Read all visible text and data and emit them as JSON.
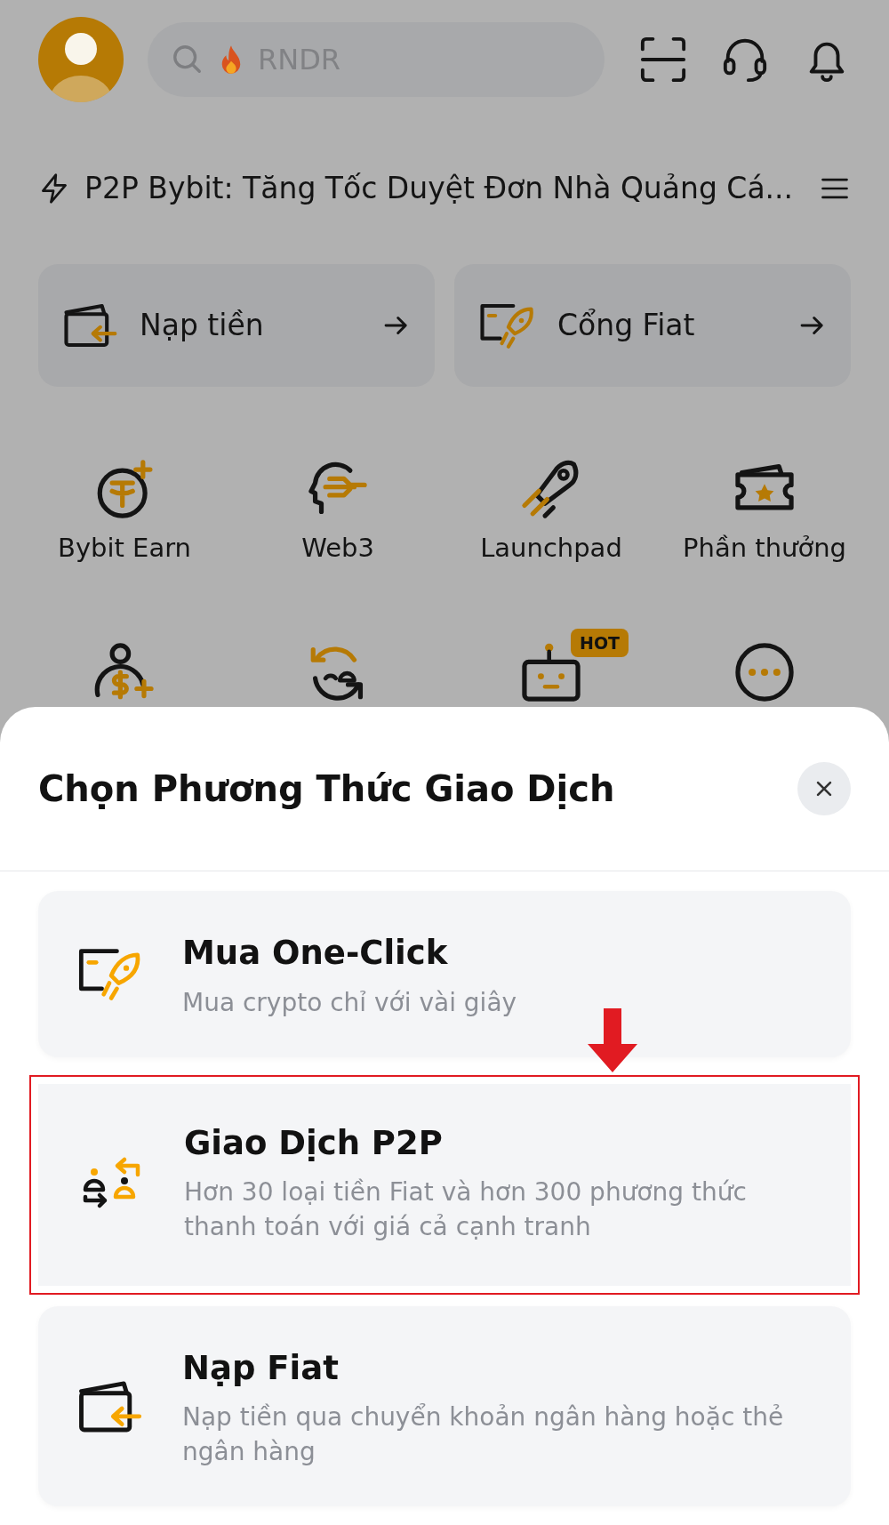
{
  "header": {
    "search": {
      "placeholder": "RNDR"
    }
  },
  "announcement": {
    "text": "P2P Bybit: Tăng Tốc Duyệt Đơn Nhà Quảng Cá..."
  },
  "quick_actions": [
    {
      "kind": "deposit",
      "label": "Nạp tiền"
    },
    {
      "kind": "fiat",
      "label": "Cổng Fiat"
    }
  ],
  "shortcuts": [
    {
      "kind": "earn",
      "label": "Bybit Earn"
    },
    {
      "kind": "web3",
      "label": "Web3"
    },
    {
      "kind": "launchpad",
      "label": "Launchpad"
    },
    {
      "kind": "rewards",
      "label": "Phần thưởng"
    },
    {
      "kind": "referral"
    },
    {
      "kind": "convert"
    },
    {
      "kind": "bot",
      "badge": "HOT"
    },
    {
      "kind": "more"
    }
  ],
  "sheet": {
    "title": "Chọn Phương Thức Giao Dịch",
    "options": [
      {
        "kind": "oneclick",
        "title": "Mua One-Click",
        "description": "Mua crypto chỉ với vài giây",
        "highlighted": false
      },
      {
        "kind": "p2p",
        "title": "Giao Dịch P2P",
        "description": "Hơn 30 loại tiền Fiat và hơn 300 phương thức thanh toán với giá cả cạnh tranh",
        "highlighted": true
      },
      {
        "kind": "deposit",
        "title": "Nạp Fiat",
        "description": "Nạp tiền qua chuyển khoản ngân hàng hoặc thẻ ngân hàng",
        "highlighted": false
      }
    ]
  }
}
